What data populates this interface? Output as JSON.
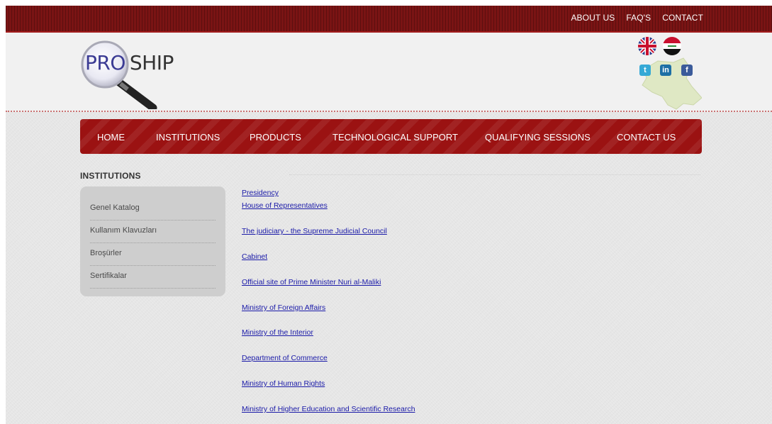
{
  "top_nav": [
    "ABOUT US",
    "FAQ'S",
    "CONTACT"
  ],
  "logo": {
    "part1": "PRO",
    "part2": "SHIP"
  },
  "social": {
    "twitter": "t",
    "linkedin": "in",
    "facebook": "f"
  },
  "main_nav": [
    "HOME",
    "INSTITUTIONS",
    "PRODUCTS",
    "TECHNOLOGICAL SUPPORT",
    "QUALIFYING SESSIONS",
    "CONTACT US"
  ],
  "section_title": "INSTITUTIONS",
  "sidebar_items": [
    "Genel Katalog",
    "Kullanım Klavuzları",
    "Broşürler",
    "Sertifikalar"
  ],
  "institution_links": [
    "Presidency",
    "House of Representatives",
    "The judiciary - the Supreme Judicial Council ",
    "Cabinet ",
    "Official site of Prime Minister Nuri al-Maliki ",
    "Ministry of Foreign Affairs",
    "Ministry of the Interior",
    "Department of Commerce ",
    "Ministry of Human Rights",
    "Ministry of Higher Education and Scientific Research "
  ],
  "colors": {
    "topbar": "#7a1414",
    "nav": "#9b1212",
    "link": "#1a1aa8",
    "map": "#dfe8c4"
  },
  "icons": [
    "magnifier-logo-icon",
    "uk-flag-icon",
    "iraq-flag-icon",
    "twitter-icon",
    "linkedin-icon",
    "facebook-icon",
    "iraq-map-graphic"
  ]
}
